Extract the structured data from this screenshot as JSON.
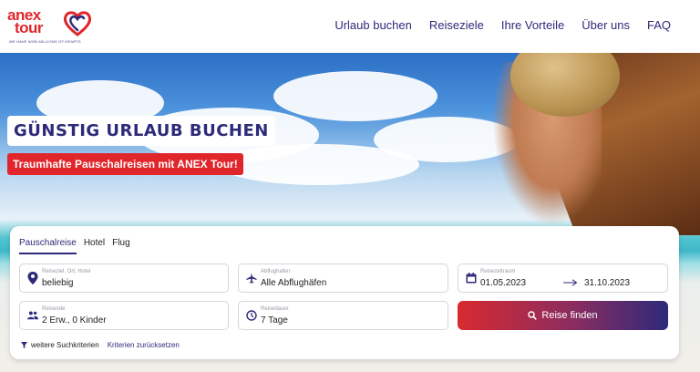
{
  "brand": {
    "line1": "anex",
    "line2": "tour",
    "tagline": "WE HAVE WON MILLIONS OF HEARTS",
    "red": "#e0252b",
    "navy": "#2d2a7a"
  },
  "nav": {
    "items": [
      "Urlaub buchen",
      "Reiseziele",
      "Ihre Vorteile",
      "Über uns",
      "FAQ"
    ]
  },
  "hero": {
    "headline": "GÜNSTIG URLAUB BUCHEN",
    "subline": "Traumhafte Pauschalreisen mit ANEX Tour!"
  },
  "search": {
    "tabs": [
      "Pauschalreise",
      "Hotel",
      "Flug"
    ],
    "active_tab": "Pauschalreise",
    "destination": {
      "label": "Reiseziel, Ort, Hotel",
      "value": "beliebig",
      "icon": "map-pin-icon"
    },
    "departure": {
      "label": "Abflughafen",
      "value": "Alle Abflughäfen",
      "icon": "plane-icon"
    },
    "dates": {
      "label": "Reisezeitraum",
      "from": "01.05.2023",
      "to": "31.10.2023",
      "icon": "calendar-icon"
    },
    "travelers": {
      "label": "Reisende",
      "value": "2 Erw., 0 Kinder",
      "icon": "people-icon"
    },
    "duration": {
      "label": "Reisedauer",
      "value": "7 Tage",
      "icon": "clock-icon"
    },
    "submit_label": "Reise finden",
    "more_filters": "weitere Suchkriterien",
    "reset": "Kriterien zurücksetzen"
  }
}
